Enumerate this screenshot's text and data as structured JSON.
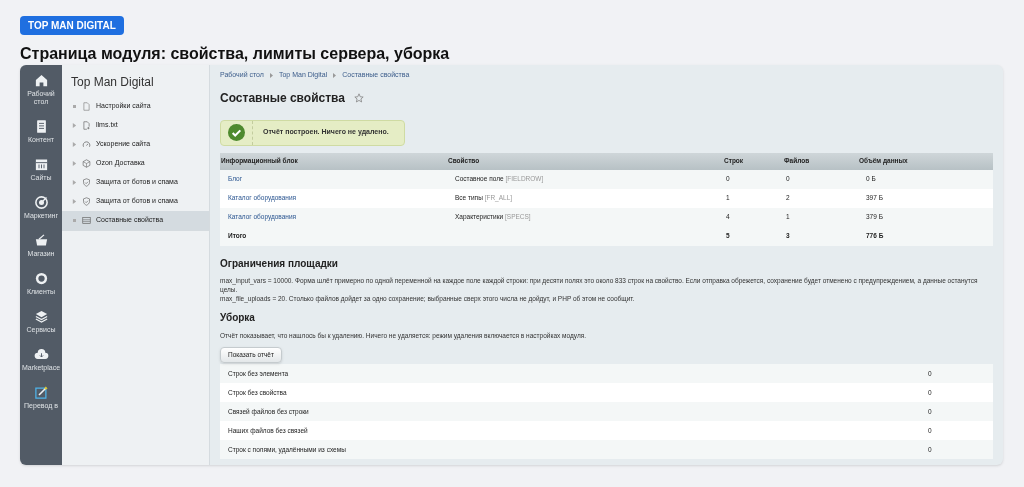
{
  "badge": "TOP MAN DIGITAL",
  "heading": "Страница модуля: свойства, лимиты сервера, уборка",
  "rail": [
    {
      "label": "Рабочий стол"
    },
    {
      "label": "Контент"
    },
    {
      "label": "Сайты"
    },
    {
      "label": "Маркетинг"
    },
    {
      "label": "Магазин"
    },
    {
      "label": "Клиенты"
    },
    {
      "label": "Сервисы"
    },
    {
      "label": "Marketplace"
    },
    {
      "label": "Перевод в"
    }
  ],
  "tree": {
    "title": "Top Man Digital",
    "items": [
      {
        "label": "Настройки сайта",
        "expandable": false,
        "selected": false
      },
      {
        "label": "llms.txt",
        "expandable": true,
        "selected": false
      },
      {
        "label": "Ускорение сайта",
        "expandable": true,
        "selected": false
      },
      {
        "label": "Ozon Доставка",
        "expandable": true,
        "selected": false
      },
      {
        "label": "Защита от ботов и спама",
        "expandable": true,
        "selected": false
      },
      {
        "label": "Защита от ботов и спама",
        "expandable": true,
        "selected": false
      },
      {
        "label": "Составные свойства",
        "expandable": false,
        "selected": true
      }
    ]
  },
  "breadcrumbs": [
    "Рабочий стол",
    "Top Man Digital",
    "Составные свойства"
  ],
  "page_title": "Составные свойства",
  "notice": "Отчёт построен. Ничего не удалено.",
  "table": {
    "columns": [
      "Информационный блок",
      "Свойство",
      "Строк",
      "Файлов",
      "Объём данных"
    ],
    "rows": [
      {
        "block": "Блог",
        "property": "Составное поле",
        "code": "[FIELDROW]",
        "rows": "0",
        "files": "0",
        "size": "0 Б"
      },
      {
        "block": "Каталог оборудования",
        "property": "Все типы",
        "code": "[FR_ALL]",
        "rows": "1",
        "files": "2",
        "size": "397 Б"
      },
      {
        "block": "Каталог оборудования",
        "property": "Характеристики",
        "code": "[SPECS]",
        "rows": "4",
        "files": "1",
        "size": "379 Б"
      }
    ],
    "total": {
      "label": "Итого",
      "rows": "5",
      "files": "3",
      "size": "776 Б"
    }
  },
  "limits": {
    "title": "Ограничения площадки",
    "lines": [
      "max_input_vars = 10000. Форма шлёт примерно по одной переменной на каждое поле каждой строки: при десяти полях это около 833 строк на свойство. Если отправка обрежется, сохранение будет отменено с предупреждением, а данные останутся целы.",
      "max_file_uploads = 20. Столько файлов дойдет за одно сохранение; выбранные сверх этого числа не дойдут, и PHP об этом не сообщит."
    ]
  },
  "cleanup": {
    "title": "Уборка",
    "text": "Отчёт показывает, что нашлось бы к удалению. Ничего не удаляется: режим удаления включается в настройках модуля.",
    "button": "Показать отчёт",
    "rows": [
      {
        "label": "Строк без элемента",
        "value": "0"
      },
      {
        "label": "Строк без свойства",
        "value": "0"
      },
      {
        "label": "Связей файлов без строки",
        "value": "0"
      },
      {
        "label": "Наших файлов без связей",
        "value": "0"
      },
      {
        "label": "Строк с полями, удалёнными из схемы",
        "value": "0"
      }
    ]
  }
}
